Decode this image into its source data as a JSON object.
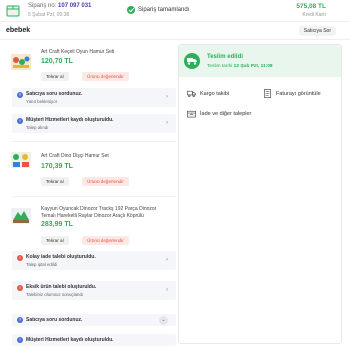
{
  "header": {
    "order_label": "Sipariş no:",
    "order_number": "107 097 031",
    "order_date": "5 Şubat Pzt, 09:38",
    "status": "Sipariş tamamlandı",
    "total_price": "575,08 TL",
    "payment_method": "Kredi Kartı"
  },
  "seller": {
    "name": "ebebek",
    "ask_seller_label": "Satıcıya Sor"
  },
  "products": [
    {
      "title": "Art Craft Keçeli Oyun Hamur Seti",
      "price": "120,70 TL",
      "reorder_label": "Tekrar al",
      "review_label": "Ürünü değerlendir"
    },
    {
      "title": "Art Craft Dino Dişçi Hamur Set",
      "price": "170,39 TL",
      "reorder_label": "Tekrar al",
      "review_label": "Ürünü değerlendir"
    },
    {
      "title": "Kayyun Oyuncak Dinozor Trackş 192 Parça Dinozor Temalı Hareketli Raylar Dinozor Araçlı Köprülü",
      "price": "283,99 TL",
      "reorder_label": "Tekrar al",
      "review_label": "Ürünü değerlendir"
    }
  ],
  "rows": {
    "q1": {
      "title": "Satıcıya soru sordunuz.",
      "subtitle": "Yanıt bekleniyor"
    },
    "cs1": {
      "title": "Müşteri Hizmetleri kaydı oluşturuldu.",
      "subtitle": "Talep alındı"
    },
    "return": {
      "title": "Kolay iade talebi oluşturuldu.",
      "subtitle": "Talep iptal edildi"
    },
    "missing": {
      "title": "Eksik ürün talebi oluşturuldu.",
      "subtitle": "Talebiniz olumsuz sonuçlandı"
    },
    "q2": {
      "title": "Satıcıya soru sordunuz."
    },
    "cs2": {
      "title": "Müşteri Hizmetleri kaydı oluşturuldu."
    }
  },
  "delivery": {
    "title": "Teslim edildi",
    "date_label": "Teslim tarihi",
    "date_value": "12 Şub Pzt, 11:08"
  },
  "actions": {
    "tracking": "Kargo takibi",
    "invoice": "Faturayı görüntüle",
    "return_requests": "İade ve diğer talepler"
  },
  "colors": {
    "accent_green": "#2dae5b",
    "accent_purple": "#4b3ab3",
    "review_red": "#e45545"
  }
}
